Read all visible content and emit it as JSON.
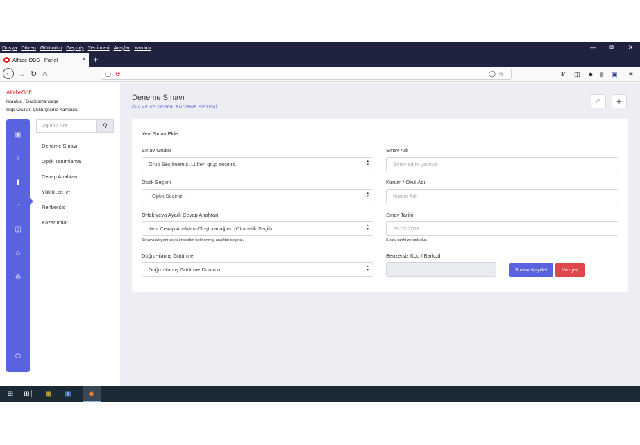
{
  "browser": {
    "menu": [
      "Dosya",
      "Düzen",
      "Görünüm",
      "Geçmiş",
      "Yer imleri",
      "Araçlar",
      "Yardım"
    ],
    "tab_title": "Alfabe OBS - Panel"
  },
  "sidebar": {
    "brand": "AlfabeSoft",
    "location_line1": "İstanbul / Gaziosmanpaşa",
    "location_line2": "Gop Okulları Çukurçeşme Kampüsü",
    "search_placeholder": "Öğrenci Ara",
    "items": [
      "Deneme Sınavı",
      "Optik Tanımlama",
      "Cevap Anahtarı",
      "Yüklü .txt ler",
      "Rehbersis",
      "Kazanımlar"
    ]
  },
  "page": {
    "title": "Deneme Sınavı",
    "subtitle": "ÖLÇME VE DEĞERLENDİRME SİSTEMİ"
  },
  "form": {
    "card_title": "Yeni Sınav Ekle",
    "group_label": "Sınav Grubu",
    "group_value": "Grup Seçilmemiş. Lütfen grup seçiniz.",
    "name_label": "Sınav Adı",
    "name_placeholder": "Sınav adını yazınız",
    "optic_label": "Optik Seçimi",
    "optic_value": "--Optik Seçiniz--",
    "school_label": "Kurum / Okul Adı",
    "school_placeholder": "Kurum Adı",
    "answer_label": "Ortak veya Ayarlı Cevap Anahtarı",
    "answer_value": "Yeni Cevap Anahtarı Oluşturacağım. (Otomatik Seçili)",
    "answer_help": "Sınava ait yeni veya önceden belirlenmiş anahtar seçiniz.",
    "date_label": "Sınav Tarihi",
    "date_placeholder": "28-02-2018",
    "date_help": "Sınav tarihi zorunludur.",
    "penalty_label": "Doğru-Yanlış Götürme",
    "penalty_value": "Doğru-Yanlış Götürme Durumu",
    "code_label": "Benzersiz Kod / Barkod",
    "save_label": "Sınavı Kaydet",
    "cancel_label": "Vazgeç"
  },
  "colors": {
    "accent": "#5a63df",
    "danger": "#e0474c",
    "brand": "#e02020",
    "chrome": "#1f2340"
  }
}
